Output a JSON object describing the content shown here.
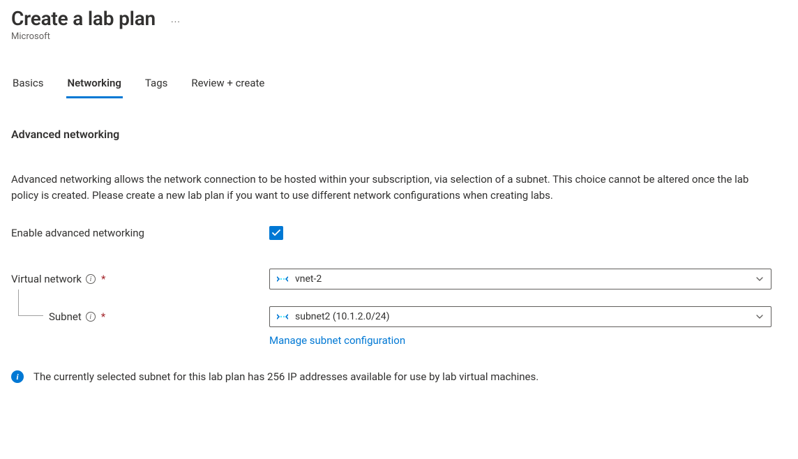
{
  "header": {
    "title": "Create a lab plan",
    "subtitle": "Microsoft"
  },
  "tabs": [
    {
      "label": "Basics",
      "active": false
    },
    {
      "label": "Networking",
      "active": true
    },
    {
      "label": "Tags",
      "active": false
    },
    {
      "label": "Review + create",
      "active": false
    }
  ],
  "section": {
    "heading": "Advanced networking",
    "description": "Advanced networking allows the network connection to be hosted within your subscription, via selection of a subnet. This choice cannot be altered once the lab policy is created. Please create a new lab plan if you want to use different network configurations when creating labs."
  },
  "form": {
    "enable_label": "Enable advanced networking",
    "enable_checked": true,
    "vnet_label": "Virtual network",
    "vnet_value": "vnet-2",
    "subnet_label": "Subnet",
    "subnet_value": "subnet2 (10.1.2.0/24)",
    "manage_link": "Manage subnet configuration",
    "info_message": "The currently selected subnet for this lab plan has 256 IP addresses available for use by lab virtual machines."
  }
}
